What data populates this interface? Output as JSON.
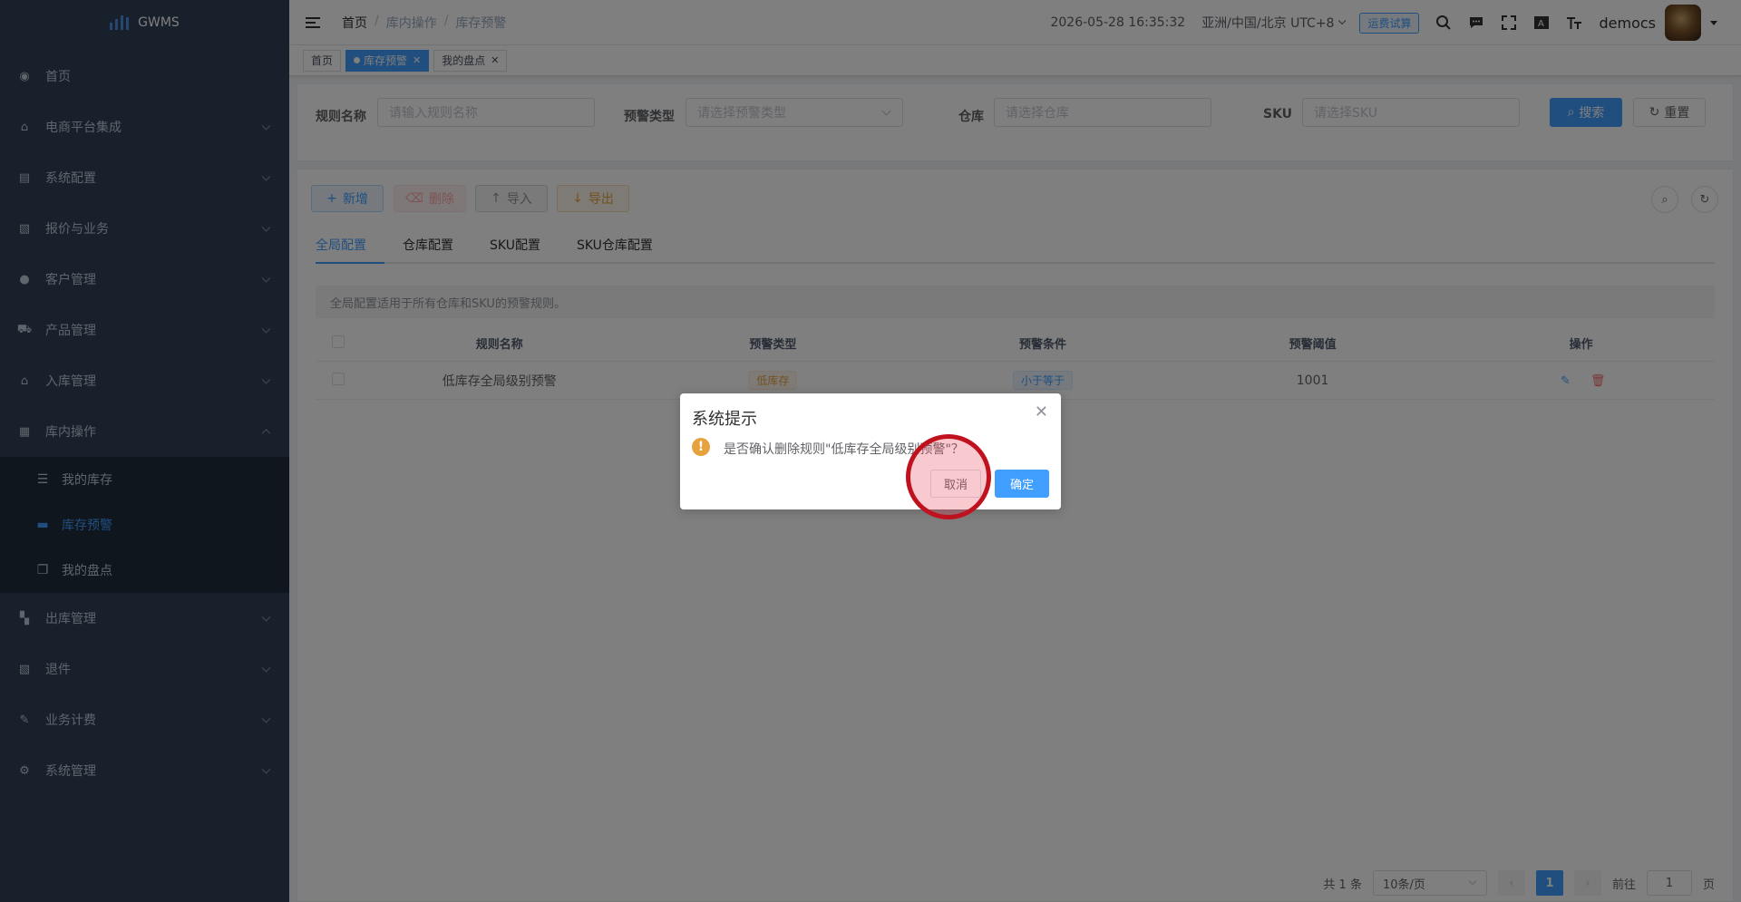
{
  "app": {
    "logo_text": "GWMS"
  },
  "sidebar": {
    "items": [
      {
        "label": "首页",
        "icon": "dashboard-icon"
      },
      {
        "label": "电商平台集成",
        "icon": "bank-icon"
      },
      {
        "label": "系统配置",
        "icon": "config-icon"
      },
      {
        "label": "报价与业务",
        "icon": "document-icon"
      },
      {
        "label": "客户管理",
        "icon": "user-icon"
      },
      {
        "label": "产品管理",
        "icon": "cart-icon"
      },
      {
        "label": "入库管理",
        "icon": "home-icon"
      },
      {
        "label": "库内操作",
        "icon": "grid-icon"
      },
      {
        "label": "出库管理",
        "icon": "apps-icon"
      },
      {
        "label": "退件",
        "icon": "return-icon"
      },
      {
        "label": "业务计费",
        "icon": "billing-icon"
      },
      {
        "label": "系统管理",
        "icon": "gear-icon"
      }
    ],
    "submenu": [
      {
        "label": "我的库存",
        "icon": "list-icon"
      },
      {
        "label": "库存预警",
        "icon": "message-icon"
      },
      {
        "label": "我的盘点",
        "icon": "copy-icon"
      }
    ]
  },
  "header": {
    "breadcrumb": [
      "首页",
      "库内操作",
      "库存预警"
    ],
    "datetime": "2026-05-28 16:35:32",
    "timezone": "亚洲/中国/北京 UTC+8",
    "trial_button": "运费试算",
    "username": "democs"
  },
  "tags": [
    {
      "label": "首页"
    },
    {
      "label": "库存预警"
    },
    {
      "label": "我的盘点"
    }
  ],
  "filter": {
    "rule_name_label": "规则名称",
    "rule_name_placeholder": "请输入规则名称",
    "type_label": "预警类型",
    "type_placeholder": "请选择预警类型",
    "warehouse_label": "仓库",
    "warehouse_placeholder": "请选择仓库",
    "sku_label": "SKU",
    "sku_placeholder": "请选择SKU",
    "search_button": "搜索",
    "reset_button": "重置"
  },
  "toolbar": {
    "add": "新增",
    "delete": "删除",
    "import": "导入",
    "export": "导出"
  },
  "tabs": [
    "全局配置",
    "仓库配置",
    "SKU配置",
    "SKU仓库配置"
  ],
  "notice": "全局配置适用于所有仓库和SKU的预警规则。",
  "table": {
    "headers": [
      "规则名称",
      "预警类型",
      "预警条件",
      "预警阈值",
      "操作"
    ],
    "rows": [
      {
        "name": "低库存全局级别预警",
        "type": "低库存",
        "condition": "小于等于",
        "threshold": "1001"
      }
    ]
  },
  "pagination": {
    "total": "共 1 条",
    "page_size": "10条/页",
    "current": "1",
    "goto_label": "前往",
    "goto_value": "1",
    "page_suffix": "页"
  },
  "dialog": {
    "title": "系统提示",
    "message": "是否确认删除规则\"低库存全局级别预警\"？",
    "cancel": "取消",
    "confirm": "确定"
  },
  "colors": {
    "primary": "#409eff",
    "sidebar_bg": "#304156",
    "warning": "#e6a23c",
    "highlight": "#c0111f"
  }
}
